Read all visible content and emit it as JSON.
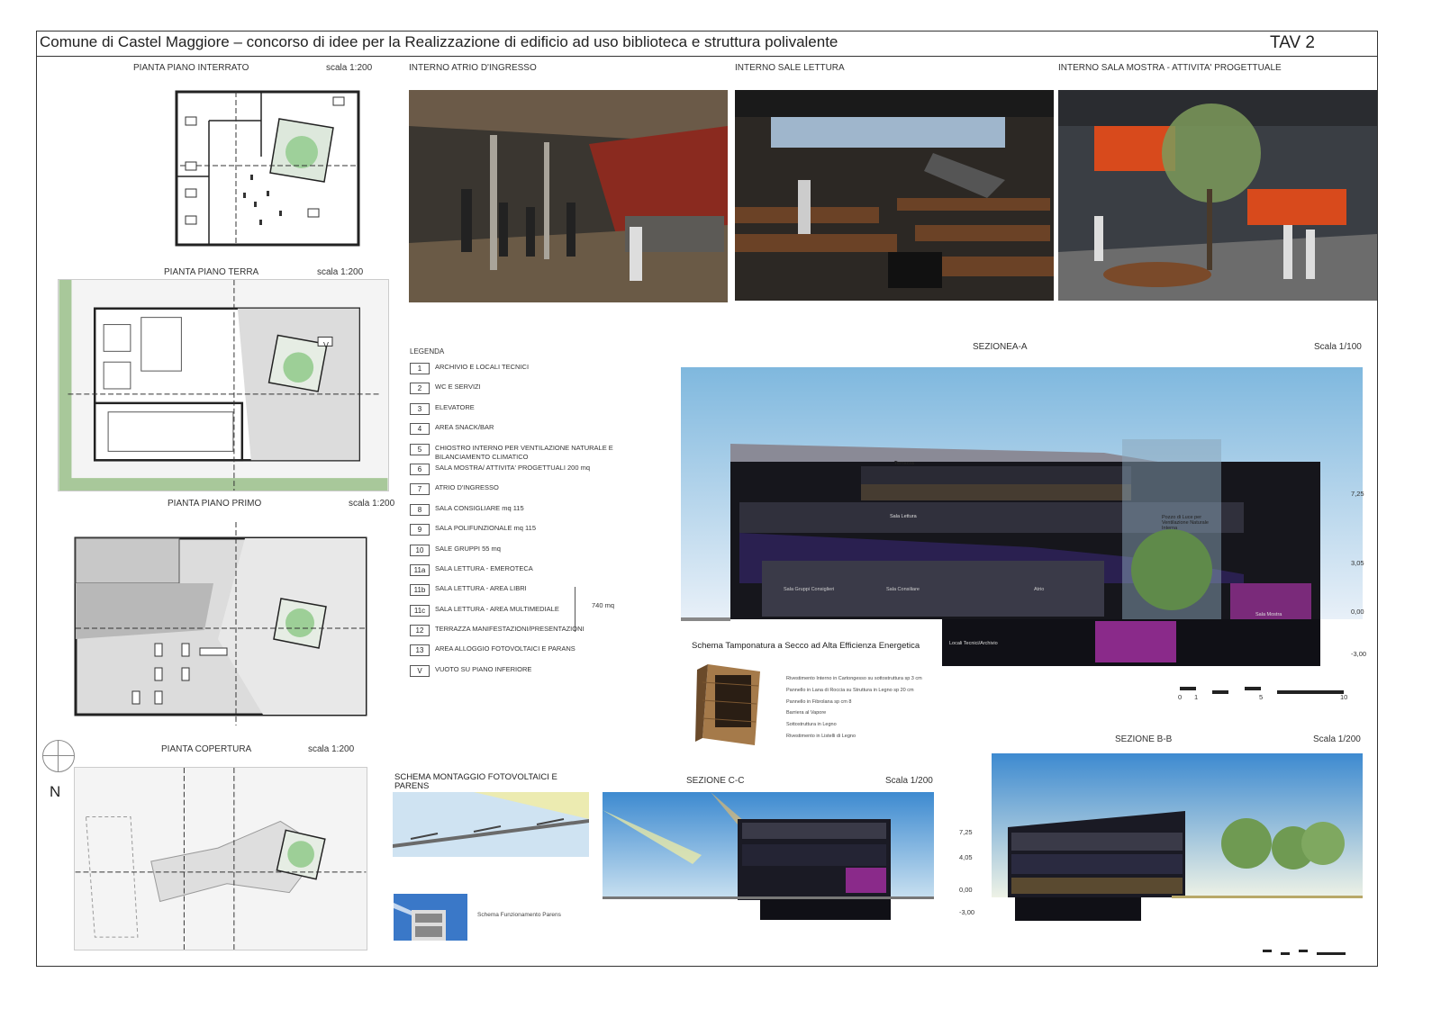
{
  "board": {
    "title": "Comune di Castel Maggiore – concorso di idee per la Realizzazione di edificio ad uso biblioteca e struttura polivalente",
    "tav": "TAV 2"
  },
  "plans": {
    "interrato": {
      "title": "PIANTA PIANO INTERRATO",
      "scale": "scala 1:200"
    },
    "terra": {
      "title": "PIANTA PIANO TERRA",
      "scale": "scala 1:200"
    },
    "primo": {
      "title": "PIANTA PIANO PRIMO",
      "scale": "scala 1:200"
    },
    "copertura": {
      "title": "PIANTA COPERTURA",
      "scale": "scala 1:200"
    }
  },
  "north_label": "N",
  "renders": {
    "atrio": "INTERNO ATRIO D'INGRESSO",
    "lettura": "INTERNO SALE LETTURA",
    "mostra": "INTERNO SALA MOSTRA - ATTIVITA' PROGETTUALE"
  },
  "legend": {
    "title": "LEGENDA",
    "items": [
      {
        "num": "1",
        "text": "ARCHIVIO E LOCALI TECNICI"
      },
      {
        "num": "2",
        "text": "WC E SERVIZI"
      },
      {
        "num": "3",
        "text": "ELEVATORE"
      },
      {
        "num": "4",
        "text": "AREA SNACK/BAR"
      },
      {
        "num": "5",
        "text": "CHIOSTRO INTERNO PER VENTILAZIONE NATURALE E BILANCIAMENTO CLIMATICO"
      },
      {
        "num": "6",
        "text": "SALA MOSTRA/ ATTIVITA' PROGETTUALI 200 mq"
      },
      {
        "num": "7",
        "text": "ATRIO D'INGRESSO"
      },
      {
        "num": "8",
        "text": "SALA CONSIGLIARE mq 115"
      },
      {
        "num": "9",
        "text": "SALA POLIFUNZIONALE mq 115"
      },
      {
        "num": "10",
        "text": "SALE GRUPPI 55 mq"
      },
      {
        "num": "11a",
        "text": "SALA LETTURA - EMEROTECA"
      },
      {
        "num": "11b",
        "text": "SALA LETTURA - AREA LIBRI"
      },
      {
        "num": "11c",
        "text": "SALA LETTURA - AREA MULTIMEDIALE"
      },
      {
        "num": "12",
        "text": "TERRAZZA MANIFESTAZIONI/PRESENTAZIONI"
      },
      {
        "num": "13",
        "text": "AREA ALLOGGIO FOTOVOLTAICI E PARANS"
      },
      {
        "num": "V",
        "text": "VUOTO SU PIANO INFERIORE"
      }
    ],
    "area_note": "740 mq"
  },
  "section_a": {
    "title": "SEZIONEA-A",
    "scale": "Scala 1/100",
    "labels": {
      "terrazza": "Terrazza",
      "sala_lettura": "Sala Lettura",
      "pozzo": "Pozzo di Luce per Ventilazione Naturale Interna",
      "gruppi": "Sala Gruppi Consiglieri",
      "consiliare": "Sala Consiliare",
      "atrio": "Atrio",
      "mostra": "Sala Mostra",
      "tecnici": "Locali Tecnici/Archivio"
    },
    "elevations": [
      "7,25",
      "3,05",
      "0,00",
      "-3,00"
    ],
    "scalebar": [
      "0",
      "1",
      "5",
      "10"
    ]
  },
  "wall_scheme": {
    "title": "Schema Tamponatura a Secco ad Alta Efficienza Energetica",
    "layers": [
      "Rivestimento Interno in Cartongesso su sottostruttura sp 3 cm",
      "Pannello in Lana di Roccia su Struttura in Legno sp 20 cm",
      "Pannello in Fibrolana sp cm 8",
      "Barriera al Vapore",
      "Sottostruttura in Legno",
      "Rivestimento in Listelli di Legno"
    ]
  },
  "pv_scheme": {
    "title": "SCHEMA MONTAGGIO FOTOVOLTAICI E PARENS",
    "parens_caption": "Schema Funzionamento Parens"
  },
  "section_c": {
    "title": "SEZIONE C-C",
    "scale": "Scala 1/200",
    "elevations": [
      "7,25",
      "4,05",
      "0,00",
      "-3,00"
    ]
  },
  "section_b": {
    "title": "SEZIONE B-B",
    "scale": "Scala 1/200"
  }
}
